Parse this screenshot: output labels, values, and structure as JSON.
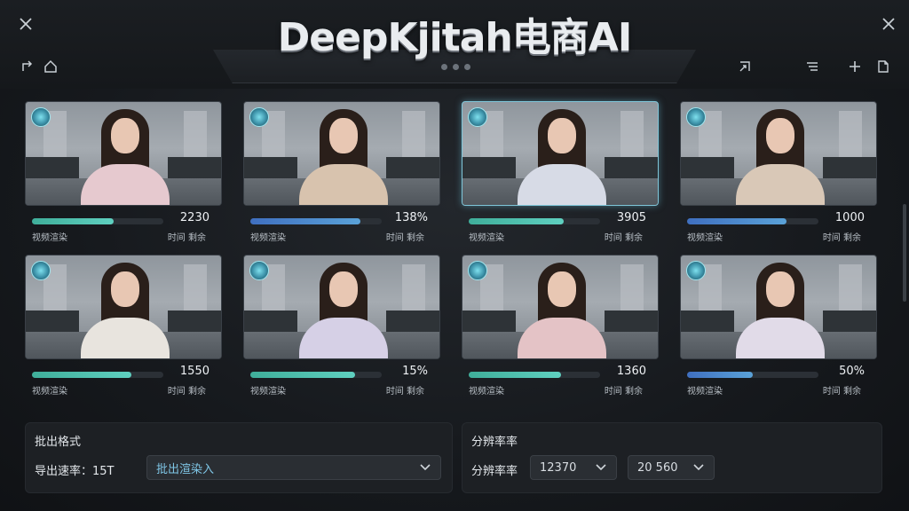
{
  "header": {
    "title": "DeepKjitah电商AI",
    "close_left_icon": "close-icon",
    "close_right_icon": "close-icon"
  },
  "toolbar": {
    "left_icons": [
      "share-icon",
      "home-icon"
    ],
    "right_icons": [
      "resize-icon",
      "list-filter-icon",
      "add-icon",
      "document-icon"
    ]
  },
  "cards": [
    {
      "value": "2230",
      "label": "视频渲染",
      "sub": "时间 剩余",
      "progress": 0.62,
      "fill": "#3fae9a",
      "shirt": "#e6c9cf"
    },
    {
      "value": "138%",
      "label": "视频渲染",
      "sub": "时间 剩余",
      "progress": 0.84,
      "fill": "#4a86c9",
      "shirt": "#d8c3ae"
    },
    {
      "value": "3905",
      "label": "视频渲染",
      "sub": "时间 剩余",
      "progress": 0.72,
      "fill": "#3fae9a",
      "shirt": "#d7dbe6"
    },
    {
      "value": "1000",
      "label": "视频渲染",
      "sub": "时间 剩余",
      "progress": 0.76,
      "fill": "#4a86c9",
      "shirt": "#d9c8b7"
    },
    {
      "value": "1550",
      "label": "视频渲染",
      "sub": "时间 剩余",
      "progress": 0.76,
      "fill": "#3fae9a",
      "shirt": "#e8e4de"
    },
    {
      "value": "15%",
      "label": "视频渲染",
      "sub": "时间 剩余",
      "progress": 0.8,
      "fill": "#3fae9a",
      "shirt": "#d6d0e6"
    },
    {
      "value": "1360",
      "label": "视频渲染",
      "sub": "时间 剩余",
      "progress": 0.7,
      "fill": "#3fae9a",
      "shirt": "#e4c3c6"
    },
    {
      "value": "50%",
      "label": "视频渲染",
      "sub": "时间 剩余",
      "progress": 0.5,
      "fill": "#4a86c9",
      "shirt": "#e1dbe8"
    }
  ],
  "export_panel": {
    "title": "批出格式",
    "label": "导出速率：15T",
    "select_value": "批出渲染入",
    "select_color": "#7fc6e6"
  },
  "resolution_panel": {
    "title": "分辨率率",
    "label": "分辨率率",
    "width_value": "12370",
    "height_value": "20 560"
  }
}
